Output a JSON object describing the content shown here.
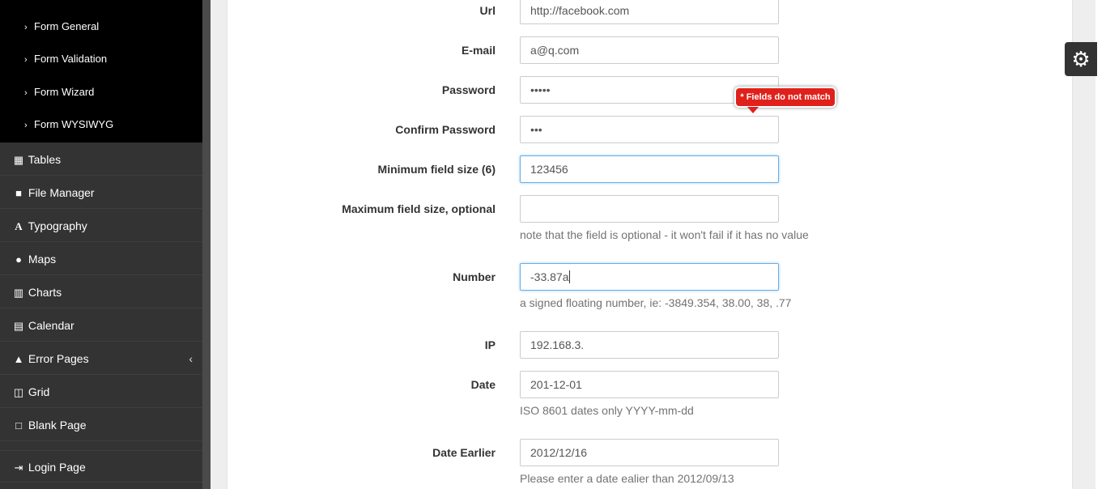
{
  "sidebar": {
    "sub_items": [
      {
        "label": "Form General"
      },
      {
        "label": "Form Validation"
      },
      {
        "label": "Form Wizard"
      },
      {
        "label": "Form WYSIWYG"
      }
    ],
    "items": [
      {
        "label": "Tables",
        "icon": "table-icon"
      },
      {
        "label": "File Manager",
        "icon": "file-icon"
      },
      {
        "label": "Typography",
        "icon": "font-icon"
      },
      {
        "label": "Maps",
        "icon": "map-marker-icon"
      },
      {
        "label": "Charts",
        "icon": "bar-chart-icon"
      },
      {
        "label": "Calendar",
        "icon": "calendar-icon"
      },
      {
        "label": "Error Pages",
        "icon": "warning-icon"
      },
      {
        "label": "Grid",
        "icon": "columns-icon"
      },
      {
        "label": "Blank Page",
        "icon": "square-icon"
      },
      {
        "label": "Login Page",
        "icon": "sign-in-icon"
      }
    ]
  },
  "form": {
    "url": {
      "label": "Url",
      "value": "http://facebook.com"
    },
    "email": {
      "label": "E-mail",
      "value": "a@q.com"
    },
    "password": {
      "label": "Password",
      "value": "•••••"
    },
    "confirm_password": {
      "label": "Confirm Password",
      "value": "•••"
    },
    "min_size": {
      "label": "Minimum field size (6)",
      "value": "123456"
    },
    "max_size": {
      "label": "Maximum field size, optional",
      "value": "",
      "help": "note that the field is optional - it won't fail if it has no value"
    },
    "number": {
      "label": "Number",
      "value": "-33.87a",
      "help": "a signed floating number, ie: -3849.354, 38.00, 38, .77"
    },
    "ip": {
      "label": "IP",
      "value": "192.168.3."
    },
    "date": {
      "label": "Date",
      "value": "201-12-01",
      "help": "ISO 8601 dates only YYYY-mm-dd"
    },
    "date_earlier": {
      "label": "Date Earlier",
      "value": "2012/12/16",
      "help": "Please enter a date ealier than 2012/09/13"
    }
  },
  "tooltip": {
    "text": "* Fields do not match",
    "color": "#e0211b"
  },
  "settings": {
    "icon": "gears-icon"
  }
}
